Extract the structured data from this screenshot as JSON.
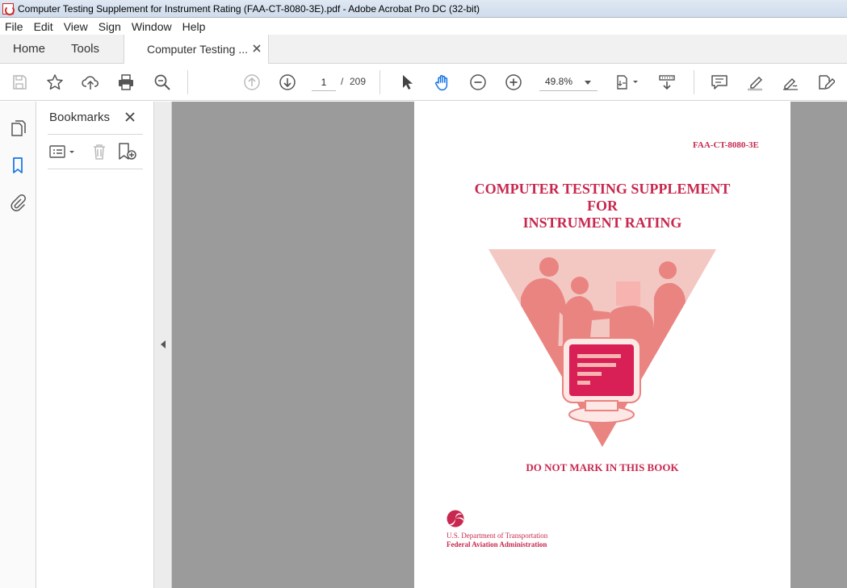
{
  "window": {
    "title": "Computer Testing Supplement for Instrument Rating (FAA-CT-8080-3E).pdf - Adobe Acrobat Pro DC (32-bit)"
  },
  "menu": [
    "File",
    "Edit",
    "View",
    "Sign",
    "Window",
    "Help"
  ],
  "tabs": {
    "home": "Home",
    "tools": "Tools",
    "document": "Computer Testing ..."
  },
  "toolbar": {
    "icons": [
      "save-icon",
      "star-icon",
      "upload-icon",
      "print-icon",
      "search-zoom-icon",
      "page-up-icon",
      "page-down-icon",
      "select-cursor-icon",
      "hand-icon",
      "zoom-out-icon",
      "zoom-in-icon",
      "fit-page-icon",
      "scroll-mode-icon",
      "comment-icon",
      "highlight-icon",
      "sign-icon",
      "edit-icon"
    ],
    "current_page": "1",
    "page_separator": "/",
    "total_pages": "209",
    "zoom": "49.8%"
  },
  "rail": {
    "icons": [
      "pages-icon",
      "bookmark-icon",
      "attachment-icon"
    ]
  },
  "bookmarks_panel": {
    "title": "Bookmarks"
  },
  "document": {
    "code": "FAA-CT-8080-3E",
    "title_line1": "COMPUTER TESTING SUPPLEMENT",
    "title_line2": "FOR",
    "title_line3": "INSTRUMENT RATING",
    "warning": "DO NOT MARK IN THIS BOOK",
    "agency_line1": "U.S. Department of Transportation",
    "agency_line2": "Federal Aviation Administration"
  },
  "colors": {
    "accent": "#c8284f",
    "doc_background": "#9b9b9b",
    "active_tool": "#1473e6"
  }
}
